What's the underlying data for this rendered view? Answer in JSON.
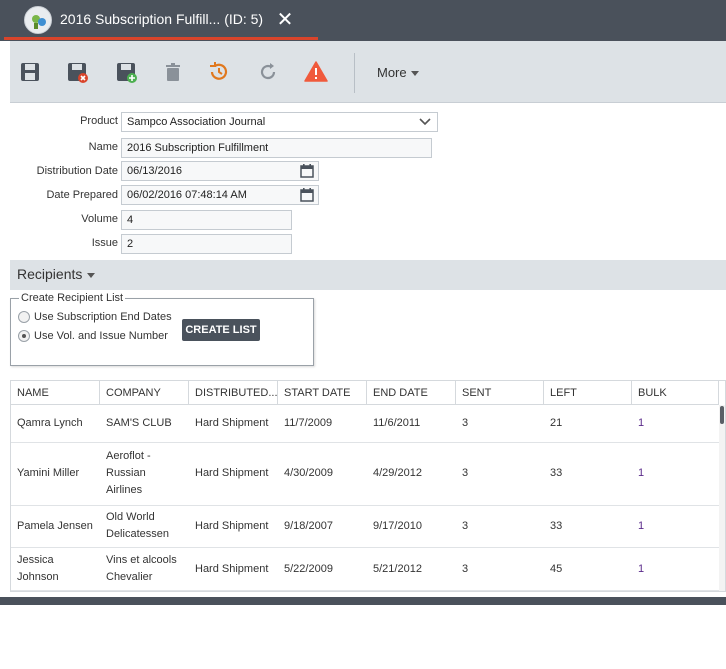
{
  "tab": {
    "title": "2016 Subscription Fulfill... (ID: 5)",
    "close": "✕",
    "icon": "app-badge-icon",
    "accent": "#d9442b"
  },
  "toolbar": {
    "buttons": [
      "save-icon",
      "save-delete-icon",
      "save-add-icon",
      "delete-icon",
      "history-icon",
      "refresh-icon",
      "warning-icon"
    ],
    "more_label": "More"
  },
  "form": {
    "product_label": "Product",
    "product_value": "Sampco Association Journal",
    "name_label": "Name",
    "name_value": "2016 Subscription Fulfillment",
    "distribution_date_label": "Distribution Date",
    "distribution_date_value": "06/13/2016",
    "date_prepared_label": "Date Prepared",
    "date_prepared_value": "06/02/2016 07:48:14 AM",
    "volume_label": "Volume",
    "volume_value": "4",
    "issue_label": "Issue",
    "issue_value": "2"
  },
  "recipients": {
    "section_title": "Recipients",
    "legend": "Create Recipient List",
    "option_end_dates": "Use Subscription End Dates",
    "option_vol_issue": "Use Vol. and Issue Number",
    "selected_option": "Use Vol. and Issue Number",
    "create_button": "CREATE LIST"
  },
  "grid": {
    "columns": [
      "NAME",
      "COMPANY",
      "DISTRIBUTED...",
      "START DATE",
      "END DATE",
      "SENT",
      "LEFT",
      "BULK"
    ],
    "rows": [
      {
        "name": "Qamra Lynch",
        "company": "SAM'S CLUB",
        "distributed": "Hard Shipment",
        "start": "11/7/2009",
        "end": "11/6/2011",
        "sent": "3",
        "left": "21",
        "bulk": "1"
      },
      {
        "name": "Yamini Miller",
        "company": "Aeroflot - Russian Airlines",
        "distributed": "Hard Shipment",
        "start": "4/30/2009",
        "end": "4/29/2012",
        "sent": "3",
        "left": "33",
        "bulk": "1"
      },
      {
        "name": "Pamela Jensen",
        "company": "Old World Delicatessen",
        "distributed": "Hard Shipment",
        "start": "9/18/2007",
        "end": "9/17/2010",
        "sent": "3",
        "left": "33",
        "bulk": "1"
      },
      {
        "name": "Jessica Johnson",
        "company": "Vins et alcools Chevalier",
        "distributed": "Hard Shipment",
        "start": "5/22/2009",
        "end": "5/21/2012",
        "sent": "3",
        "left": "45",
        "bulk": "1"
      }
    ]
  }
}
